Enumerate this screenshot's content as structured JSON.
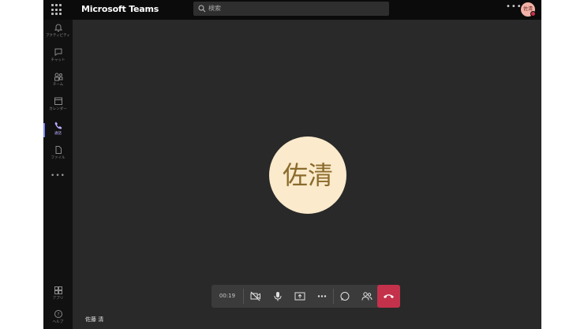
{
  "app": {
    "title": "Microsoft Teams"
  },
  "search": {
    "placeholder": "検索"
  },
  "header": {
    "more_label": "•••",
    "avatar_initials": "佐清"
  },
  "rail": {
    "items": [
      {
        "label": "アクティビティ",
        "icon": "bell-icon"
      },
      {
        "label": "チャット",
        "icon": "chat-icon"
      },
      {
        "label": "チーム",
        "icon": "teams-icon"
      },
      {
        "label": "カレンダー",
        "icon": "calendar-icon"
      },
      {
        "label": "通話",
        "icon": "phone-icon",
        "active": true
      },
      {
        "label": "ファイル",
        "icon": "file-icon"
      }
    ],
    "more_label": "•••",
    "bottom": [
      {
        "label": "アプリ",
        "icon": "apps-icon"
      },
      {
        "label": "ヘルプ",
        "icon": "help-icon"
      }
    ]
  },
  "call": {
    "avatar_text": "佐清",
    "avatar_color": "#fbeacb",
    "participant_name": "佐藤 清",
    "timer": "00:19",
    "controls": [
      "camera-off-icon",
      "mic-icon",
      "share-screen-icon",
      "more-icon",
      "chat-bubble-icon",
      "participants-icon",
      "hang-up-icon"
    ],
    "hangup_color": "#c4314b"
  },
  "colors": {
    "accent": "#7f85f5",
    "stage": "#292929",
    "rail": "#111111"
  }
}
